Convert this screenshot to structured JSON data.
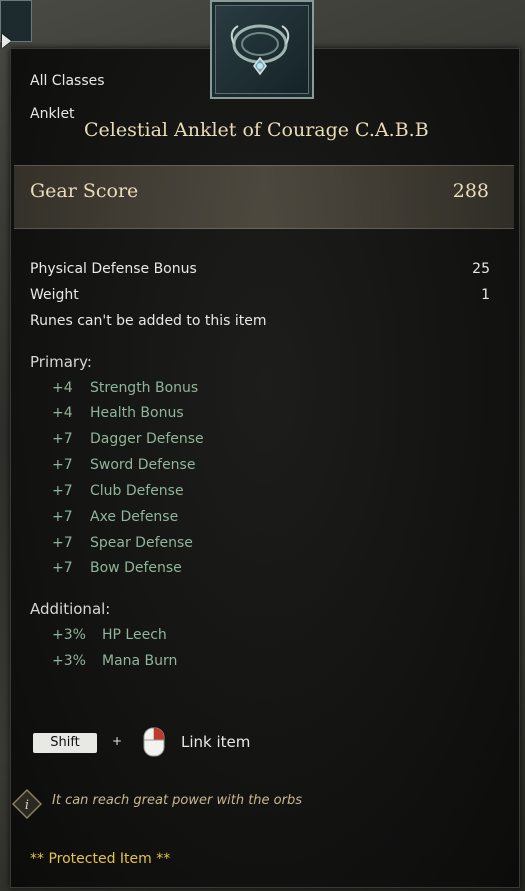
{
  "item": {
    "class_restriction": "All Classes",
    "slot": "Anklet",
    "name": "Celestial Anklet of Courage C.A.B.B",
    "gear_score_label": "Gear Score",
    "gear_score_value": "288",
    "base_stats": [
      {
        "label": "Physical Defense Bonus",
        "value": "25"
      },
      {
        "label": "Weight",
        "value": "1"
      }
    ],
    "rune_note": "Runes can't be added to this item",
    "primary_label": "Primary:",
    "primary": [
      {
        "value": "+4",
        "name": "Strength Bonus"
      },
      {
        "value": "+4",
        "name": "Health Bonus"
      },
      {
        "value": "+7",
        "name": "Dagger Defense"
      },
      {
        "value": "+7",
        "name": "Sword Defense"
      },
      {
        "value": "+7",
        "name": "Club Defense"
      },
      {
        "value": "+7",
        "name": "Axe Defense"
      },
      {
        "value": "+7",
        "name": "Spear Defense"
      },
      {
        "value": "+7",
        "name": "Bow Defense"
      }
    ],
    "additional_label": "Additional:",
    "additional": [
      {
        "value": "+3%",
        "name": "HP Leech"
      },
      {
        "value": "+3%",
        "name": "Mana Burn"
      }
    ],
    "shift_key": "Shift",
    "plus": "+",
    "link_label": "Link item",
    "hint": "It can reach great power with the orbs",
    "protected": "** Protected Item **"
  },
  "colors": {
    "title": "#eadcb9",
    "stat_green": "#8fb59a",
    "protected_gold": "#e6c24a",
    "hint_tan": "#c9b890"
  },
  "icons": [
    "anklet-icon",
    "mouse-right-click-icon",
    "info-icon",
    "cursor-arrow-icon"
  ]
}
